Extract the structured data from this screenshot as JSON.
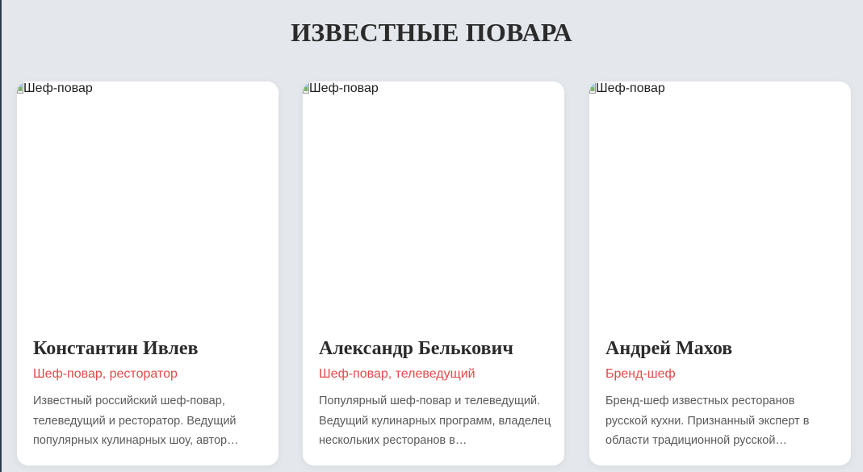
{
  "section": {
    "title": "ИЗВЕСТНЫЕ ПОВАРА"
  },
  "chefs": [
    {
      "image_alt": "Шеф-повар",
      "name": "Константин Ивлев",
      "role": "Шеф-повар, ресторатор",
      "description": "Известный российский шеф-повар, телеведущий и ресторатор. Ведущий популярных кулинарных шоу, автор…"
    },
    {
      "image_alt": "Шеф-повар",
      "name": "Александр Белькович",
      "role": "Шеф-повар, телеведущий",
      "description": "Популярный шеф-повар и телеведущий. Ведущий кулинарных программ, владелец нескольких ресторанов в…"
    },
    {
      "image_alt": "Шеф-повар",
      "name": "Андрей Махов",
      "role": "Бренд-шеф",
      "description": "Бренд-шеф известных ресторанов русской кухни. Признанный эксперт в области традиционной русской…"
    }
  ],
  "colors": {
    "page_background": "#e4e8ec",
    "card_background": "#ffffff",
    "role_accent": "#e34a4a",
    "title_text": "#2b2b2b",
    "body_text": "#5a5a5a"
  },
  "icons": {
    "image_placeholder": "broken-image-icon"
  }
}
